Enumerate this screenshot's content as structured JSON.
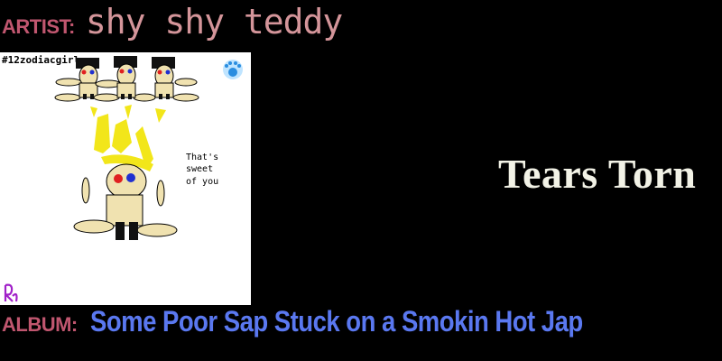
{
  "artist": {
    "label": "ARTIST:",
    "name": "shy shy teddy"
  },
  "album": {
    "label": "ALBUM:",
    "name": "Some Poor Sap Stuck on a Smokin Hot Jap"
  },
  "song": {
    "title": "Tears Torn"
  },
  "cover": {
    "hashtag": "#12zodiacgirl",
    "speech_line1": "That's",
    "speech_line2": "sweet",
    "speech_line3": "of you",
    "paw_icon": "paw-print-icon",
    "signature_icon": "signature-icon"
  },
  "colors": {
    "background": "#000000",
    "label": "#c0566f",
    "artist_name": "#d4959a",
    "album_name": "#5a78f0",
    "song_title": "#f2f2e6",
    "cover_bg": "#ffffff",
    "yellow": "#f2e61a",
    "skin": "#f0e2b0"
  }
}
